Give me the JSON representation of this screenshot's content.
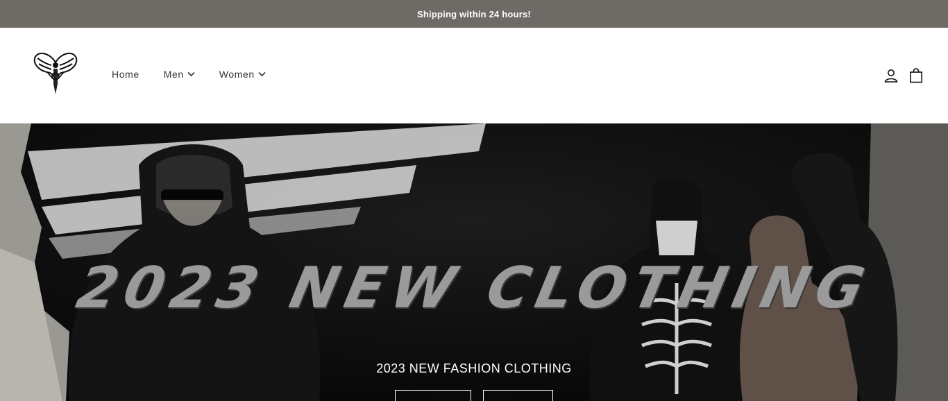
{
  "announcement": {
    "text": "Shipping within 24 hours!"
  },
  "header": {
    "nav": [
      {
        "label": "Home",
        "has_dropdown": false
      },
      {
        "label": "Men",
        "has_dropdown": true
      },
      {
        "label": "Women",
        "has_dropdown": true
      }
    ],
    "icons": [
      "account-icon",
      "cart-icon"
    ]
  },
  "hero": {
    "title": "2023 NEW CLOTHING",
    "subtitle": "2023 NEW FASHION CLOTHING",
    "buttons": [
      "",
      ""
    ]
  },
  "colors": {
    "announcement_bg": "#6e6b67",
    "hero_title": "#9a9a9a",
    "hero_bg": "#0e0e0e"
  }
}
